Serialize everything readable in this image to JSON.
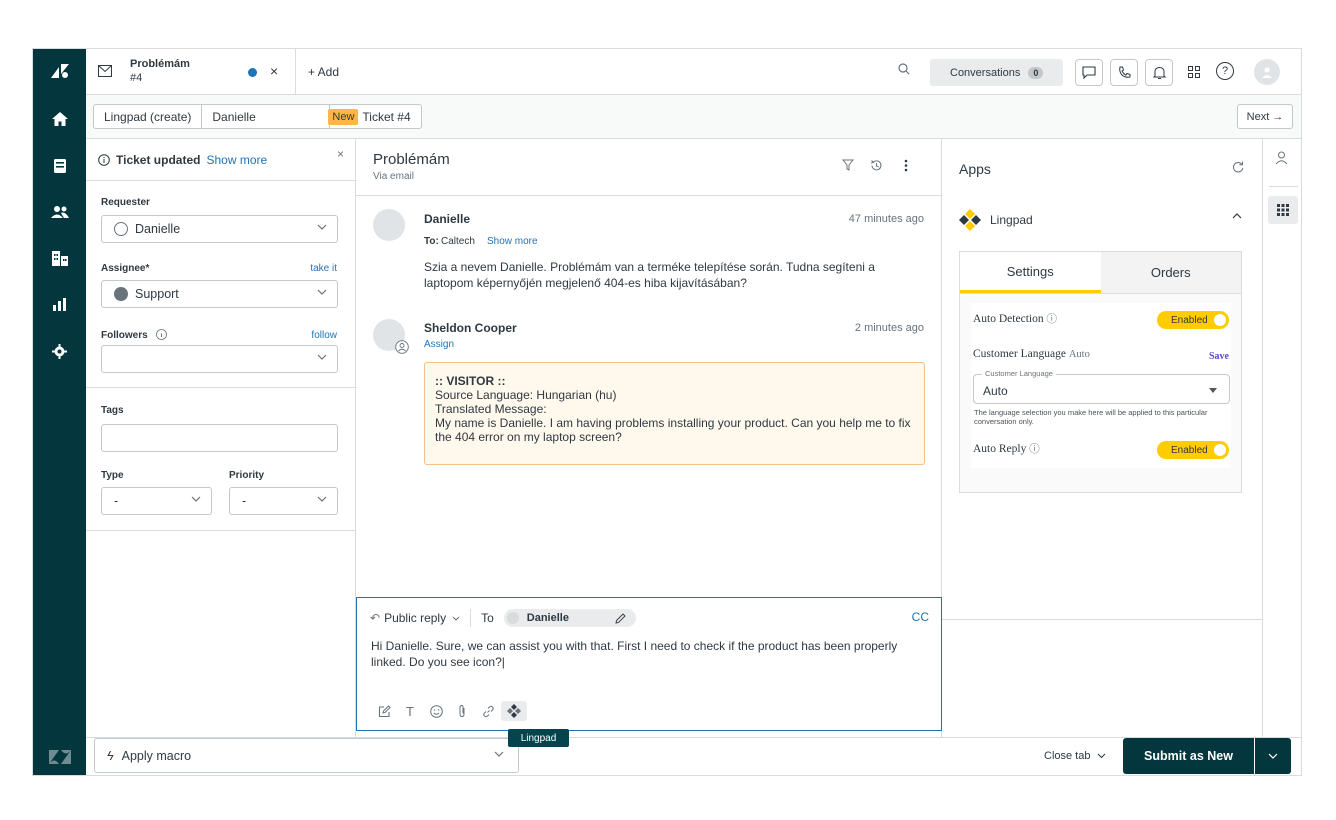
{
  "header": {
    "ticket_tab_title": "Problémám",
    "ticket_tab_number": "#4",
    "add_tab_label": "+ Add",
    "conversations_label": "Conversations",
    "conversations_count": "0",
    "help_label": "?"
  },
  "subheader": {
    "breadcrumbs": [
      "Lingpad (create)",
      "Danielle"
    ],
    "status_badge": "New",
    "ticket_label": "Ticket #4",
    "next_label": "Next →"
  },
  "properties": {
    "updated_title": "Ticket updated",
    "updated_link": "Show more",
    "requester_label": "Requester",
    "requester_value": "Danielle",
    "assignee_label": "Assignee*",
    "assignee_link": "take it",
    "assignee_value": "Support",
    "followers_label": "Followers",
    "followers_link": "follow",
    "tags_label": "Tags",
    "type_label": "Type",
    "type_value": "-",
    "priority_label": "Priority",
    "priority_value": "-"
  },
  "conversation": {
    "title": "Problémám",
    "via": "Via email",
    "messages": [
      {
        "author": "Danielle",
        "time": "47 minutes ago",
        "to_prefix": "To:",
        "to_value": "Caltech",
        "show_more": "Show more",
        "body": "Szia a nevem Danielle. Problémám van a terméke telepítése során. Tudna segíteni a laptopom képernyőjén megjelenő 404-es hiba kijavításában?"
      },
      {
        "author": "Sheldon Cooper",
        "time": "2 minutes ago",
        "assign": "Assign",
        "visitor_header": ":: VISITOR ::",
        "source_language": "Source Language: Hungarian (hu)",
        "translated_label": "Translated Message:",
        "translated_body": "My name is Danielle. I am having problems installing your product. Can you help me to fix the 404 error on my laptop screen?"
      }
    ]
  },
  "reply": {
    "mode_label": "Public reply",
    "to_label": "To",
    "recipient": "Danielle",
    "cc_label": "CC",
    "text": "Hi Danielle. Sure, we can assist you with that. First I need to check if the product has been properly linked. Do you see icon?|",
    "tooltip": "Lingpad"
  },
  "apps": {
    "title": "Apps",
    "app_name": "Lingpad",
    "tabs": [
      "Settings",
      "Orders"
    ],
    "auto_detection_label": "Auto Detection",
    "auto_detection_status": "Enabled",
    "customer_language_label": "Customer Language",
    "customer_language_current": "Auto",
    "save_label": "Save",
    "select_legend": "Customer Language",
    "select_value": "Auto",
    "helper_text": "The language selection you make here will be applied to this particular conversation only.",
    "auto_reply_label": "Auto Reply",
    "auto_reply_status": "Enabled"
  },
  "footer": {
    "macro_label": "Apply macro",
    "close_tab_label": "Close tab",
    "submit_label": "Submit as New"
  },
  "colors": {
    "nav_background": "#03363d",
    "accent_blue": "#1f73b7",
    "badge_new": "#ffb648",
    "visitor_box": "#fff8ed",
    "lingpad_yellow": "#ffcc00"
  }
}
